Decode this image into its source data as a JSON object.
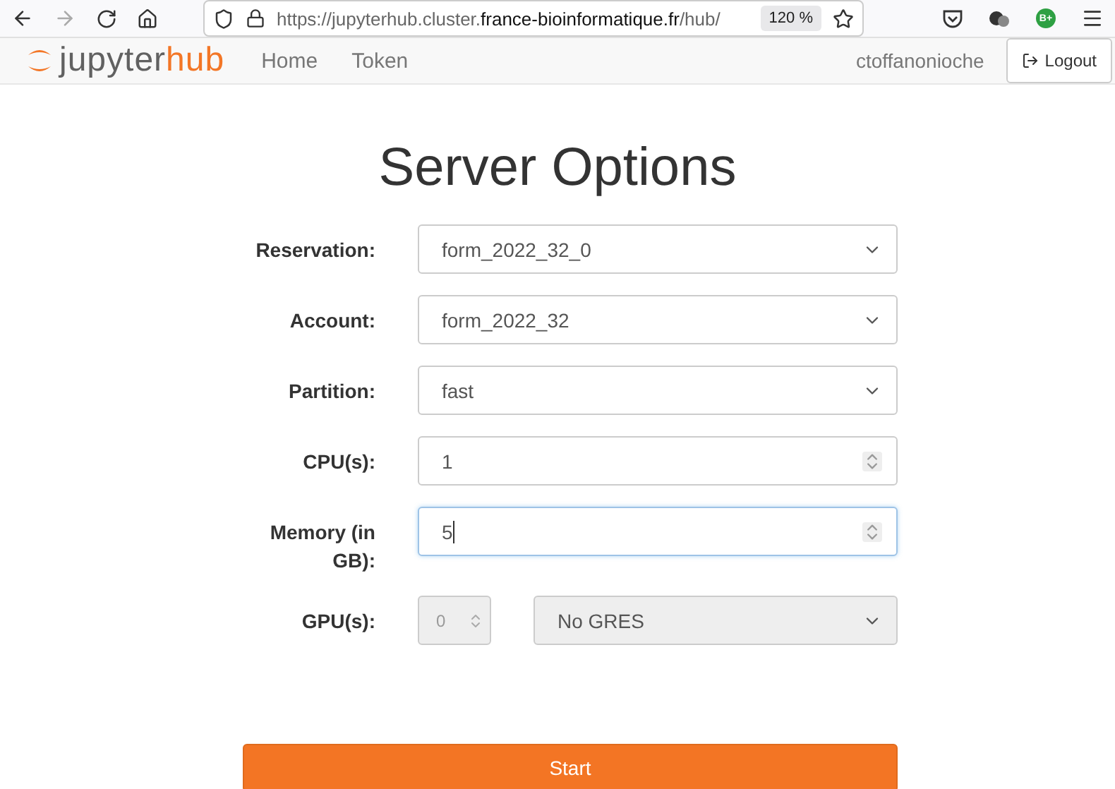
{
  "browser": {
    "url": {
      "host_prefix": "https://jupyterhub.cluster.",
      "domain": "france-bioinformatique.fr",
      "path": "/hub/"
    },
    "zoom": "120 %",
    "extension_badge": "B+"
  },
  "navbar": {
    "brand": {
      "first": "jupyter",
      "second": "hub"
    },
    "links": [
      {
        "label": "Home"
      },
      {
        "label": "Token"
      }
    ],
    "user": "ctoffanonioche",
    "logout": "Logout"
  },
  "title": "Server Options",
  "rows": [
    {
      "label": "Reservation:",
      "controls": [
        {
          "kind": "select",
          "value": "form_2022_32_0",
          "disabled": false,
          "focused": false
        }
      ]
    },
    {
      "label": "Account:",
      "controls": [
        {
          "kind": "select",
          "value": "form_2022_32",
          "disabled": false,
          "focused": false
        }
      ]
    },
    {
      "label": "Partition:",
      "controls": [
        {
          "kind": "select",
          "value": "fast",
          "disabled": false,
          "focused": false
        }
      ]
    },
    {
      "label": "CPU(s):",
      "controls": [
        {
          "kind": "number",
          "value": "1",
          "disabled": false,
          "focused": false
        }
      ]
    },
    {
      "label": "Memory (in GB):",
      "controls": [
        {
          "kind": "number",
          "value": "5",
          "disabled": false,
          "focused": true
        }
      ]
    },
    {
      "label": "GPU(s):",
      "controls": [
        {
          "kind": "small-number",
          "value": "0",
          "disabled": true,
          "focused": false
        },
        {
          "kind": "select",
          "value": "No GRES",
          "disabled": true,
          "focused": false
        }
      ]
    }
  ],
  "start_button": "Start"
}
